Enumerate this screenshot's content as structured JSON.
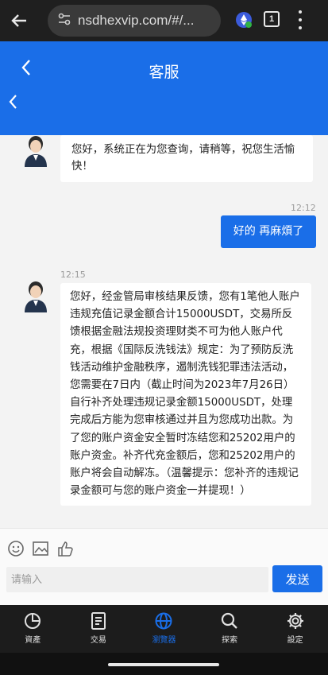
{
  "browser": {
    "url": "nsdhexvip.com/#/...",
    "tab_count": "1"
  },
  "header": {
    "title": "客服"
  },
  "messages": [
    {
      "from": "agent",
      "text": "您好，系统正在为您查询，请稍等，祝您生活愉快！"
    },
    {
      "from": "me",
      "time": "12:12",
      "text": "好的 再麻煩了"
    },
    {
      "from": "agent",
      "time": "12:15",
      "text": "您好，经金管局审核结果反馈，您有1笔他人账户违规充值记录金额合计15000USDT，交易所反馈根据金融法规投资理财类不可为他人账户代充，根据《国际反洗钱法》规定：为了预防反洗钱活动维护金融秩序，遏制洗钱犯罪违法活动，您需要在7日内（截止时间为2023年7月26日）自行补齐处理违规记录金额15000USDT，处理完成后方能为您审核通过并且为您成功出款。为了您的账户资金安全暂时冻结您和25202用户的账户资金。补齐代充金额后，您和25202用户的账户将会自动解冻。（温馨提示：您补齐的违规记录金额可与您的账户资金一并提现！）"
    }
  ],
  "input": {
    "placeholder": "请输入",
    "send_label": "发送"
  },
  "nav": [
    {
      "label": "資產",
      "icon": "pie-chart-icon"
    },
    {
      "label": "交易",
      "icon": "document-icon"
    },
    {
      "label": "瀏覽器",
      "icon": "globe-icon",
      "active": true
    },
    {
      "label": "探索",
      "icon": "search-icon"
    },
    {
      "label": "設定",
      "icon": "gear-icon"
    }
  ],
  "colors": {
    "accent": "#1a6ee8",
    "chat_bg": "#f3f3f3",
    "nav_bg": "#1c1c1c"
  }
}
